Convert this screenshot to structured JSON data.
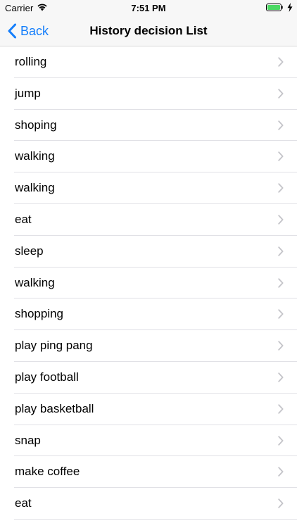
{
  "status_bar": {
    "carrier": "Carrier",
    "time": "7:51 PM",
    "battery_color": "#4cd964"
  },
  "nav": {
    "back_label": "Back",
    "title": "History decision List",
    "accent_color": "#147efb"
  },
  "items": [
    {
      "label": "rolling"
    },
    {
      "label": "jump"
    },
    {
      "label": "shoping"
    },
    {
      "label": "walking"
    },
    {
      "label": "walking"
    },
    {
      "label": "eat"
    },
    {
      "label": "sleep"
    },
    {
      "label": "walking"
    },
    {
      "label": "shopping"
    },
    {
      "label": "play ping pang"
    },
    {
      "label": "play football"
    },
    {
      "label": "play basketball"
    },
    {
      "label": "snap"
    },
    {
      "label": "make coffee"
    },
    {
      "label": "eat"
    }
  ],
  "icons": {
    "wifi": "wifi-icon",
    "battery": "battery-icon",
    "charging": "charging-bolt-icon",
    "back": "chevron-left-icon",
    "disclosure": "chevron-right-icon"
  }
}
